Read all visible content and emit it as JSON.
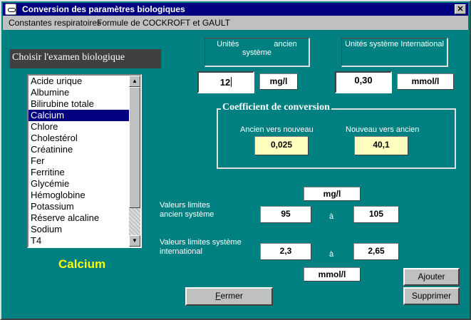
{
  "window": {
    "title": "Conversion des paramètres biologiques",
    "close_glyph": "✕"
  },
  "menu": {
    "items": [
      "Constantes respiratoires",
      "Formule de COCKROFT et GAULT"
    ]
  },
  "exam_selector": {
    "label": "Choisir l'examen biologique",
    "items": [
      "Acide urique",
      "Albumine",
      "Bilirubine totale",
      "Calcium",
      "Chlore",
      "Cholestérol",
      "Créatinine",
      "Fer",
      "Ferritine",
      "Glycémie",
      "Hémoglobine",
      "Potassium",
      "Réserve alcaline",
      "Sodium",
      "T4"
    ],
    "selected_index": 3,
    "selected_name": "Calcium"
  },
  "units": {
    "old_header_line1": "Unités                ancien",
    "old_header_line2": "système",
    "si_header": "Unités système International",
    "old_value": "12",
    "old_unit": "mg/l",
    "si_value": "0,30",
    "si_unit": "mmol/l"
  },
  "coefficient": {
    "title": "Coefficient de conversion",
    "old_to_new_label": "Ancien vers nouveau",
    "old_to_new_value": "0,025",
    "new_to_old_label": "Nouveau vers ancien",
    "new_to_old_value": "40,1"
  },
  "limits": {
    "old_unit": "mg/l",
    "old_label_line1": "Valeurs limites",
    "old_label_line2": "ancien système",
    "old_min": "95",
    "old_sep": "à",
    "old_max": "105",
    "si_label_line1": "Valeurs limites système",
    "si_label_line2": "international",
    "si_min": "2,3",
    "si_sep": "à",
    "si_max": "2,65",
    "si_unit": "mmol/l"
  },
  "buttons": {
    "close_label_first": "F",
    "close_label_rest": "ermer",
    "add_label": "Ajouter",
    "delete_label": "Supprimer"
  },
  "scrollbar": {
    "up_glyph": "▲",
    "down_glyph": "▼"
  },
  "colors": {
    "window_bg": "#008080",
    "titlebar": "#000080",
    "selected_name": "#ffff00",
    "coef_field": "#ffffc0"
  }
}
